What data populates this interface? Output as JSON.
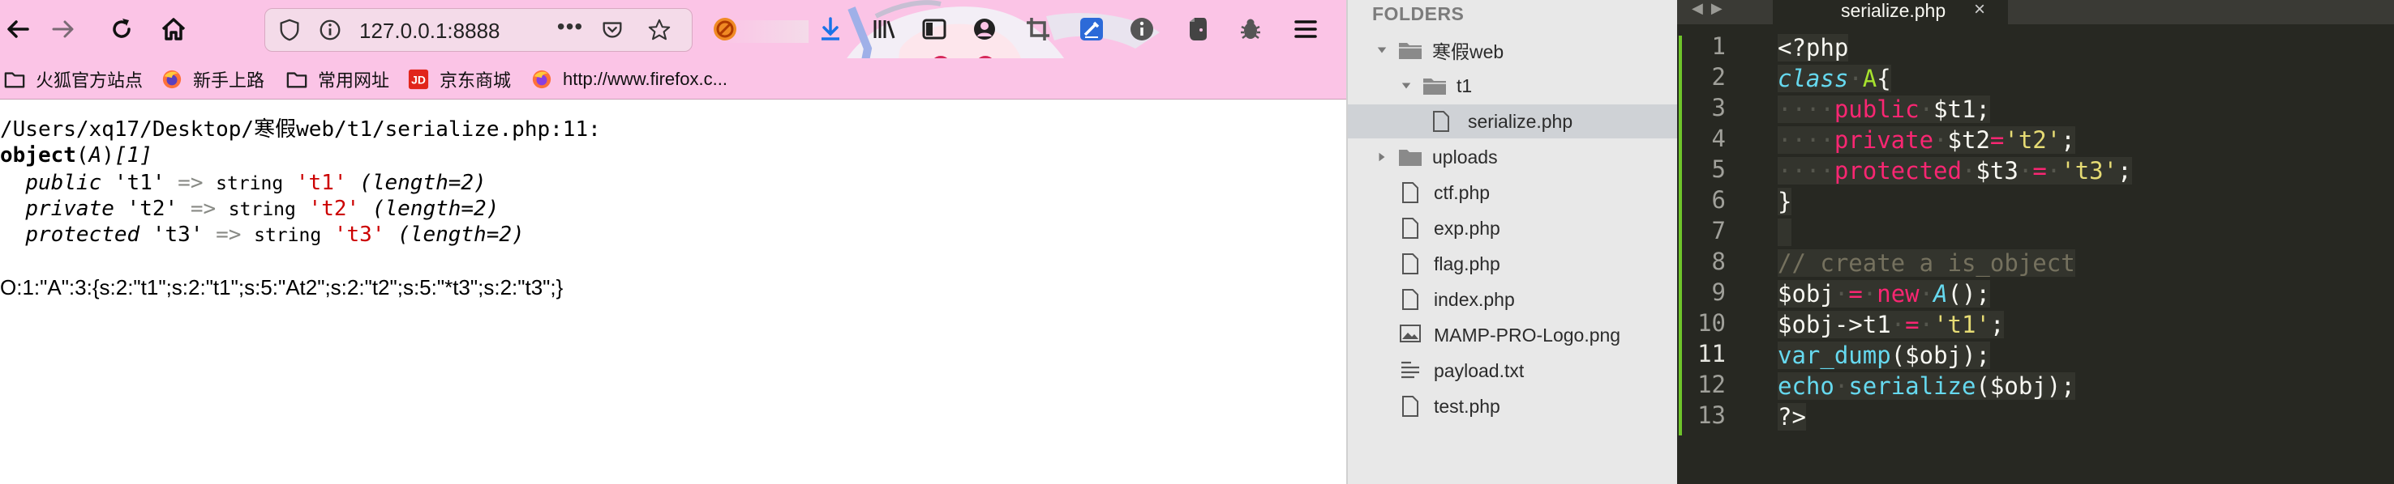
{
  "browser": {
    "url": "127.0.0.1:8888",
    "bookmarks": [
      {
        "label": "火狐官方站点",
        "icon": "folder-icon"
      },
      {
        "label": "新手上路",
        "icon": "firefox-icon"
      },
      {
        "label": "常用网址",
        "icon": "folder-icon"
      },
      {
        "label": "京东商城",
        "icon": "jd-icon"
      },
      {
        "label": "http://www.firefox.c...",
        "icon": "firefox-icon"
      }
    ],
    "output": {
      "path_line": "/Users/xq17/Desktop/寒假web/t1/serialize.php:11:",
      "object_kw": "object",
      "object_class": "A",
      "object_count": "[1]",
      "props": [
        {
          "visibility": "public",
          "name": "'t1'",
          "arrow": "=>",
          "type": "string",
          "value": "'t1'",
          "length": "(length=2)"
        },
        {
          "visibility": "private",
          "name": "'t2'",
          "arrow": "=>",
          "type": "string",
          "value": "'t2'",
          "length": "(length=2)"
        },
        {
          "visibility": "protected",
          "name": "'t3'",
          "arrow": "=>",
          "type": "string",
          "value": "'t3'",
          "length": "(length=2)"
        }
      ],
      "serialized": "O:1:\"A\":3:{s:2:\"t1\";s:2:\"t1\";s:5:\"At2\";s:2:\"t2\";s:5:\"*t3\";s:2:\"t3\";}"
    }
  },
  "sidebar": {
    "title": "FOLDERS",
    "root": "寒假web",
    "subfolder": "t1",
    "active_file": "serialize.php",
    "uploads": "uploads",
    "files": [
      "ctf.php",
      "exp.php",
      "flag.php",
      "index.php",
      "MAMP-PRO-Logo.png",
      "payload.txt",
      "test.php"
    ]
  },
  "editor": {
    "tab_title": "serialize.php",
    "line_numbers": [
      "1",
      "2",
      "3",
      "4",
      "5",
      "6",
      "7",
      "8",
      "9",
      "10",
      "11",
      "12",
      "13"
    ],
    "lines": {
      "l1": "<?php",
      "l2_kw": "class",
      "l2_name": "A",
      "l2_brace": "{",
      "l3_mod": "public",
      "l3_var": "$t1;",
      "l4_mod": "private",
      "l4_var": "$t2",
      "l4_eq": "=",
      "l4_str": "'t2'",
      "l4_end": ";",
      "l5_mod": "protected",
      "l5_var": "$t3",
      "l5_eq": "=",
      "l5_str": "'t3'",
      "l5_end": ";",
      "l6": "}",
      "l8": "// create a is_object",
      "l9_var": "$obj",
      "l9_eq": "=",
      "l9_new": "new",
      "l9_cls": "A",
      "l9_end": "();",
      "l10_var": "$obj->t1",
      "l10_eq": "=",
      "l10_str": "'t1'",
      "l10_end": ";",
      "l11_fn": "var_dump",
      "l11_args": "($obj);",
      "l12_fn": "echo",
      "l12_fn2": "serialize",
      "l12_args": "($obj);",
      "l13": "?>"
    }
  },
  "colors": {
    "toolbar_bg": "#fbc4e6",
    "editor_bg": "#272822",
    "sidebar_bg": "#e8e8e8",
    "gutter_green": "#6ec42a"
  }
}
